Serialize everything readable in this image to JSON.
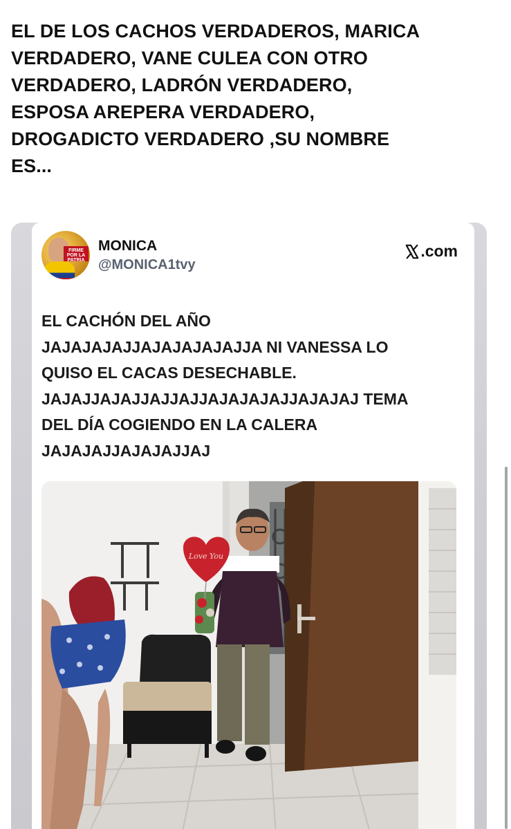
{
  "post": {
    "caption_lines": [
      "EL DE LOS CACHOS VERDADEROS, MARICA",
      "VERDADERO, VANE CULEA CON OTRO",
      "VERDADERO, LADRÓN VERDADERO,",
      "ESPOSA AREPERA VERDADERO,",
      "DROGADICTO VERDADERO ,SU NOMBRE",
      "ES..."
    ]
  },
  "embedded_tweet": {
    "avatar_badge_lines": [
      "FIRME",
      "POR LA",
      "PATRIA"
    ],
    "author_name": "MONICA",
    "author_handle": "@MONICA1tvy",
    "source_label": ".com",
    "source_icon": "x-logo-icon",
    "text_lines": [
      "EL CACHÓN DEL AÑO",
      "JAJAJAJAJJAJAJAJAJAJJA NI VANESSA LO",
      "QUISO EL CACAS DESECHABLE.",
      "JAJAJJAJAJJAJJAJJAJAJAJAJJAJAJAJ TEMA",
      "DEL DÍA COGIENDO EN LA CALERA",
      "JAJAJAJJAJAJAJJAJ"
    ],
    "photo": {
      "description_icon": "photo-image",
      "balloon_text": "Love You"
    }
  },
  "colors": {
    "text_primary": "#111111",
    "handle_gray": "#5b6270",
    "frame_gray": "#cfcfd4",
    "door_brown": "#6b4226",
    "balloon_red": "#c8232c"
  }
}
